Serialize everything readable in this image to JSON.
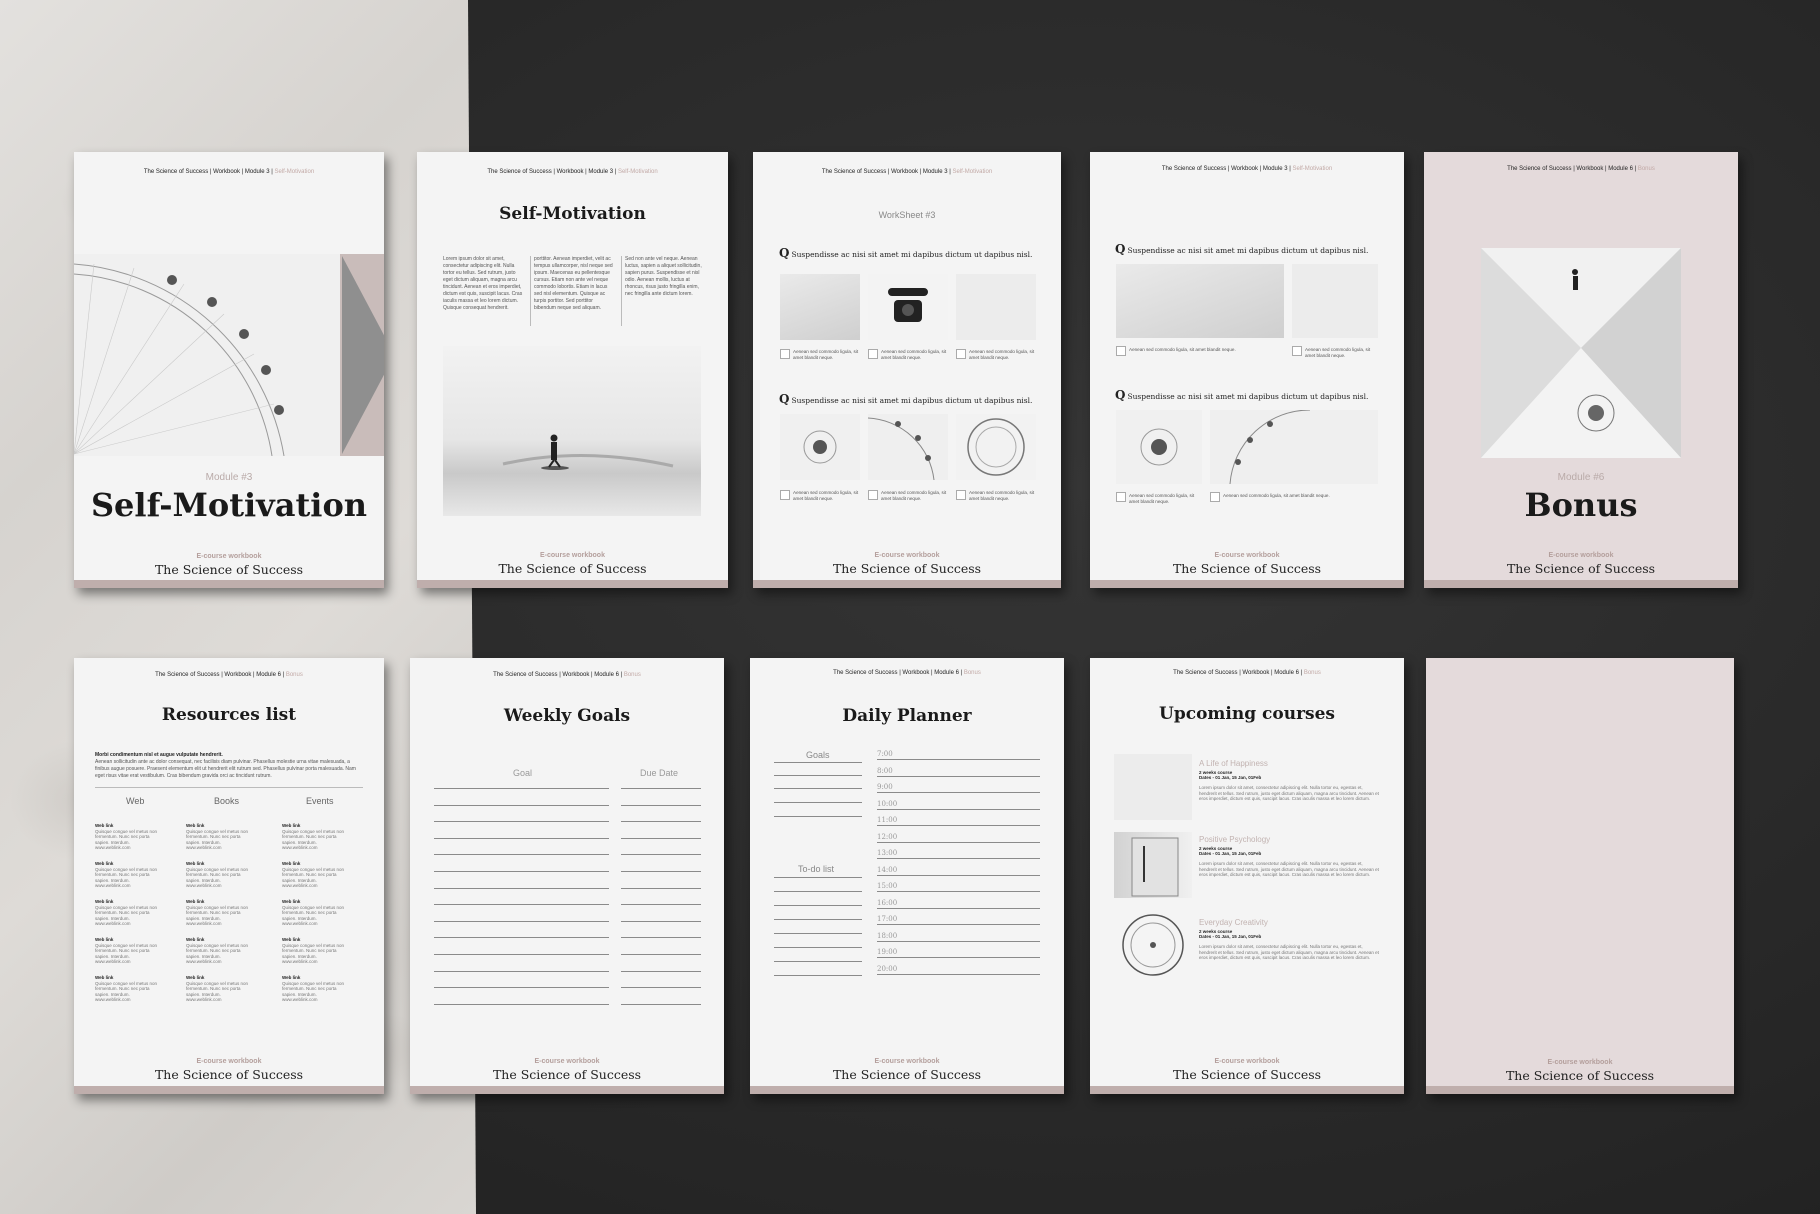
{
  "header": {
    "prefix_module3": "The Science of Success | Workbook | Module 3 |",
    "highlight_module3": "Self-Motivation",
    "prefix_module6": "The Science of Success | Workbook | Module 6 |",
    "highlight_module6": "Bonus"
  },
  "footer": {
    "sub": "E-course workbook",
    "main": "The Science of Success"
  },
  "page1": {
    "module": "Module #3",
    "title": "Self-Motivation"
  },
  "page2": {
    "title": "Self-Motivation",
    "col1": "Lorem ipsum dolor sit amet, consectetur adipiscing elit. Nulla tortor eu tellus. Sed rutrum, justo eget dictum aliquam, magna arcu tincidunt. Aenean et eros imperdiet, dictum est quis, suscipit lacus. Cras iaculis massa et leo lorem dictum. Quisque consequat hendrerit.",
    "col2": "porttitor. Aenean imperdiet, velit ac tempus ullamcorper, nisl neque sed ipsum. Maecenas eu pellentesque cursus. Etiam non ante vel neque commodo lobortis. Etiam in lacus sed nisl elementum. Quisque ac turpis portitor. Sed porttitor bibendum neque sed aliquam.",
    "col3": "Sed non ante vel neque. Aenean luctus, sapien a aliquet sollicitudin, sapien purus. Suspendisse et nisl odio. Aenean mollis, luctus at rhoncus, risus justo fringilla enim, nec fringilla ante dictum lorem."
  },
  "page3": {
    "worksheet": "WorkSheet #3",
    "question": "Suspendisse ac nisi sit amet mi dapibus dictum ut dapibus nisl.",
    "caption": "Aenean sed commodo ligula, sit amet blandit neque."
  },
  "page5": {
    "module": "Module #6",
    "title": "Bonus"
  },
  "page6": {
    "title": "Resources list",
    "intro_bold": "Morbi condimentum nisl et augue vulputate hendrerit.",
    "intro": "Aenean sollicitudin ante ac dolor consequat, nec facilisis diam pulvinar. Phasellus molestie urna vitae malesuada, a finibus augue posuere. Praesent elementum elit ut hendrerit elit rutrum sed. Phasellus pulvinar porta malesuada. Nam eget risus vitae erat vestibulum. Cras bibendum gravida orci ac tincidunt rutrum.",
    "columns": [
      "Web",
      "Books",
      "Events"
    ],
    "item_title": "Web link",
    "item_text": "Quisque congue vel metus non fermentum. Nunc nec porta sapien. Interdum.",
    "item_url": "www.weblink.com"
  },
  "page7": {
    "title": "Weekly Goals",
    "col_goal": "Goal",
    "col_due": "Due Date"
  },
  "page8": {
    "title": "Daily Planner",
    "goals": "Goals",
    "todo": "To-do list",
    "times": [
      "7:00",
      "8:00",
      "9:00",
      "10:00",
      "11:00",
      "12:00",
      "13:00",
      "14:00",
      "15:00",
      "16:00",
      "17:00",
      "18:00",
      "19:00",
      "20:00"
    ]
  },
  "page9": {
    "title": "Upcoming courses",
    "courses": [
      {
        "name": "A Life of Happiness",
        "length": "2 weeks course",
        "dates": "Dates - 01 Jan, 15 Jan, 01Feb"
      },
      {
        "name": "Positive Psychology",
        "length": "2 weeks course",
        "dates": "Dates - 01 Jan, 15 Jan, 01Feb"
      },
      {
        "name": "Everyday Creativity",
        "length": "2 weeks course",
        "dates": "Dates - 01 Jan, 15 Jan, 01Feb"
      }
    ],
    "desc": "Lorem ipsum dolor sit amet, consectetur adipiscing elit. Nulla tortor eu, egestas et, hendrerit et tellus. Sed rutrum, justo eget dictum aliquam, magna arcu tincidunt. Aenean et eros imperdiet, dictum est quis, suscipit lacus. Cras iaculis massa et leo lorem dictum."
  },
  "colors": {
    "accent": "#bfaeac",
    "pink_page": "#e4dadb",
    "page": "#f4f4f4",
    "background": "#2b2b2b"
  }
}
